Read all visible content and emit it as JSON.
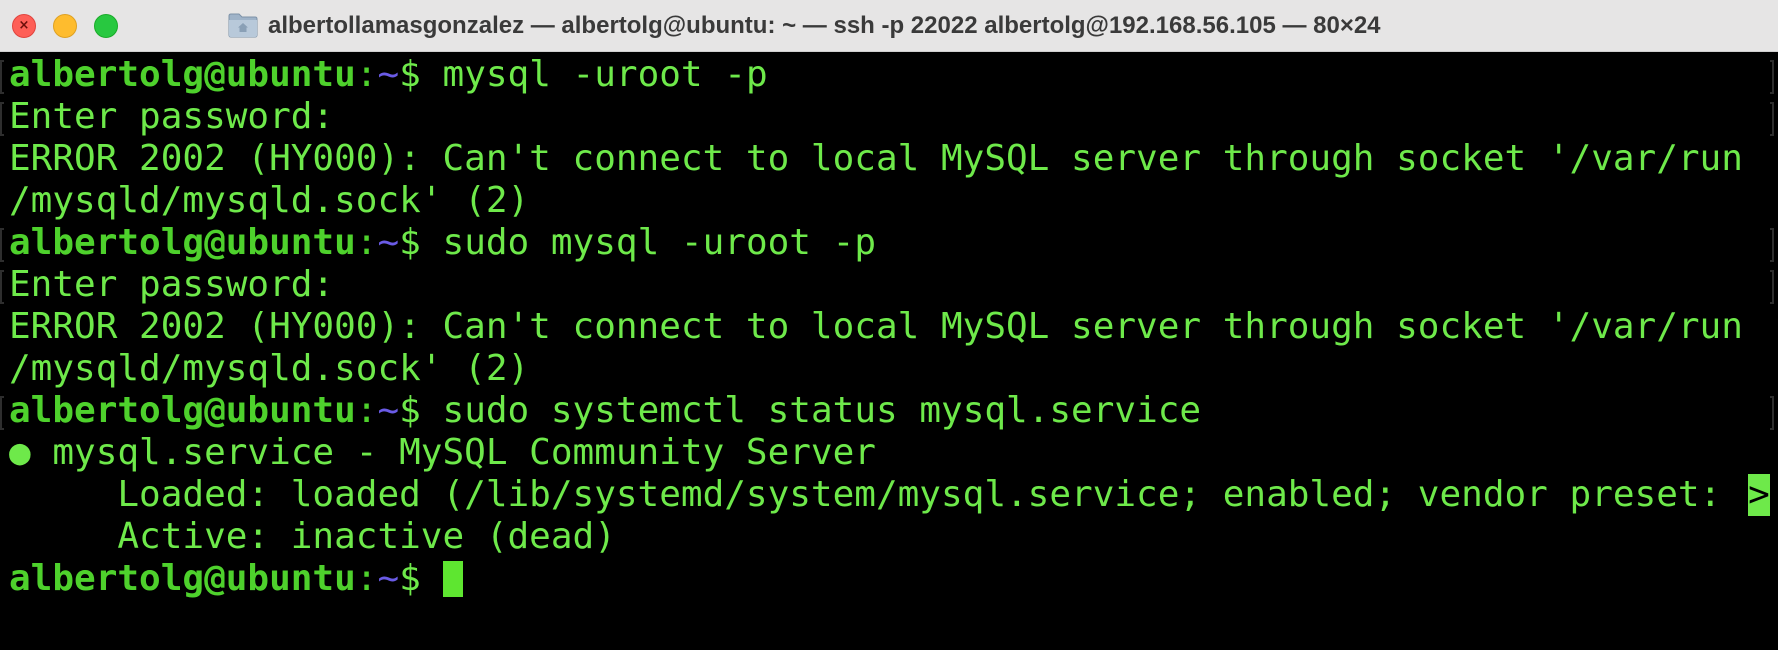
{
  "window": {
    "title": "albertollamasgonzalez — albertolg@ubuntu: ~ — ssh -p 22022 albertolg@192.168.56.105 — 80×24",
    "folder_icon": "folder-home-icon"
  },
  "colors": {
    "user_host": "#4ed12c",
    "path": "#6a5be6",
    "output": "#6ee94a",
    "background": "#000000",
    "cursor": "#5ee630"
  },
  "terminal": {
    "prompt": {
      "user_host": "albertolg@ubuntu",
      "sep": ":",
      "path": "~",
      "symbol": "$ "
    },
    "lines": [
      {
        "type": "prompt",
        "command": "mysql -uroot -p"
      },
      {
        "type": "output",
        "text": "Enter password:"
      },
      {
        "type": "output",
        "text": "ERROR 2002 (HY000): Can't connect to local MySQL server through socket '/var/run"
      },
      {
        "type": "output",
        "text": "/mysqld/mysqld.sock' (2)"
      },
      {
        "type": "prompt",
        "command": "sudo mysql -uroot -p"
      },
      {
        "type": "output",
        "text": "Enter password:"
      },
      {
        "type": "output",
        "text": "ERROR 2002 (HY000): Can't connect to local MySQL server through socket '/var/run"
      },
      {
        "type": "output",
        "text": "/mysqld/mysqld.sock' (2)"
      },
      {
        "type": "prompt",
        "command": "sudo systemctl status mysql.service"
      },
      {
        "type": "output",
        "text": "● mysql.service - MySQL Community Server"
      },
      {
        "type": "output",
        "text": "     Loaded: loaded (/lib/systemd/system/mysql.service; enabled; vendor preset:"
      },
      {
        "type": "output",
        "text": "     Active: inactive (dead)"
      },
      {
        "type": "prompt",
        "command": ""
      }
    ],
    "truncation_marker": ">"
  }
}
